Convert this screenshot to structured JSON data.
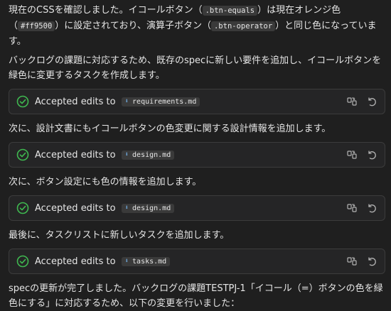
{
  "intro": {
    "p1_a": "現在のCSSを確認しました。イコールボタン（",
    "p1_code1": ".btn-equals",
    "p1_b": "）は現在オレンジ色（",
    "p1_code2": "#ff9500",
    "p1_c": "）に設定されており、演算子ボタン（",
    "p1_code3": ".btn-operator",
    "p1_d": "）と同じ色になっています。",
    "p2": "バックログの課題に対応するため、既存のspecに新しい要件を追加し、イコールボタンを緑色に変更するタスクを作成します。"
  },
  "cards": [
    {
      "label": "Accepted edits to",
      "file": "requirements.md"
    },
    {
      "label": "Accepted edits to",
      "file": "design.md"
    },
    {
      "label": "Accepted edits to",
      "file": "design.md"
    },
    {
      "label": "Accepted edits to",
      "file": "tasks.md"
    }
  ],
  "steps": {
    "s1": "次に、設計文書にもイコールボタンの色変更に関する設計情報を追加します。",
    "s2": "次に、ボタン設定にも色の情報を追加します。",
    "s3": "最後に、タスクリストに新しいタスクを追加します。",
    "final": "specの更新が完了しました。バックログの課題TESTPJ-1「イコール（=）ボタンの色を緑色にする」に対応するため、以下の変更を行いました："
  },
  "icons": {
    "check": "check-circle-icon",
    "file": "markdown-file-icon",
    "compare": "compare-icon",
    "revert": "revert-icon"
  },
  "colors": {
    "check": "#3fb950",
    "md": "#6fa8dc"
  }
}
